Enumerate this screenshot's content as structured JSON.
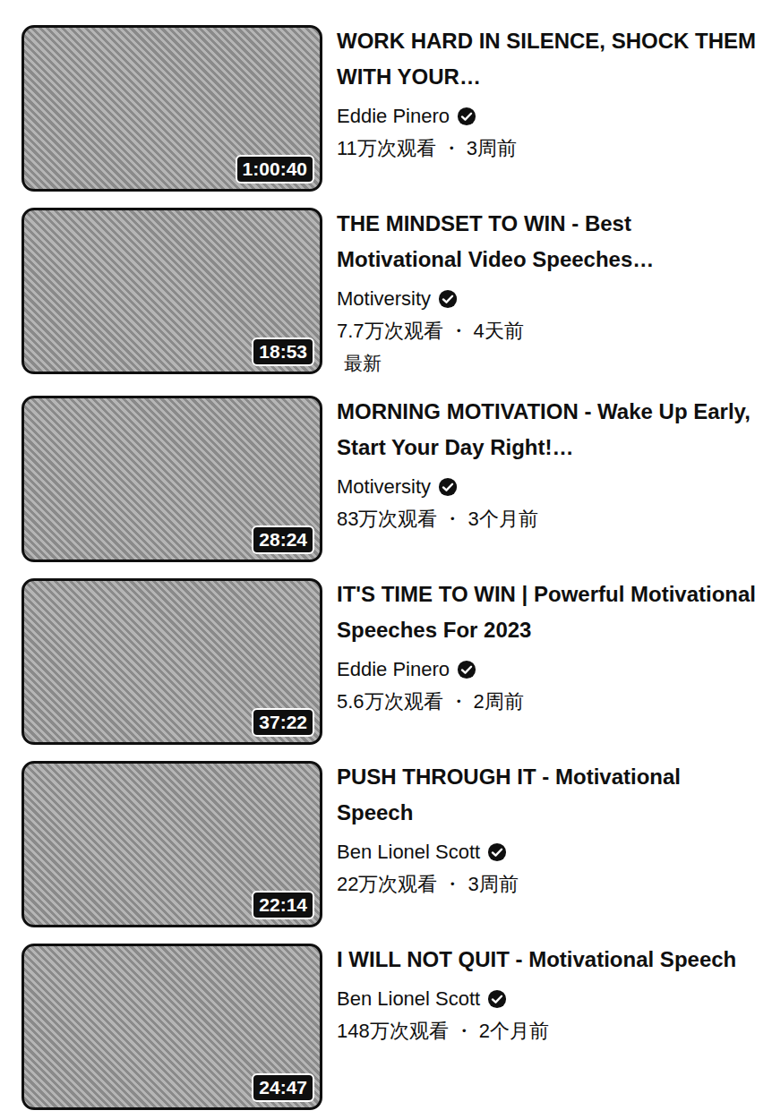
{
  "separator": "・",
  "videos": [
    {
      "title": "WORK HARD IN SILENCE, SHOCK THEM WITH YOUR…",
      "channel": "Eddie Pinero",
      "verified": true,
      "views": "11万次观看",
      "age": "3周前",
      "duration": "1:00:40"
    },
    {
      "title": "THE MINDSET TO WIN - Best Motivational Video Speeches…",
      "channel": "Motiversity",
      "verified": true,
      "views": "7.7万次观看",
      "age": "4天前",
      "duration": "18:53",
      "badge": "最新"
    },
    {
      "title": "MORNING MOTIVATION - Wake Up Early, Start Your Day Right!…",
      "channel": "Motiversity",
      "verified": true,
      "views": "83万次观看",
      "age": "3个月前",
      "duration": "28:24"
    },
    {
      "title": "IT'S TIME TO WIN | Powerful Motivational Speeches For 2023",
      "channel": "Eddie Pinero",
      "verified": true,
      "views": "5.6万次观看",
      "age": "2周前",
      "duration": "37:22"
    },
    {
      "title": "PUSH THROUGH IT - Motivational Speech",
      "channel": "Ben Lionel Scott",
      "verified": true,
      "views": "22万次观看",
      "age": "3周前",
      "duration": "22:14"
    },
    {
      "title": "I WILL NOT QUIT - Motivational Speech",
      "channel": "Ben Lionel Scott",
      "verified": true,
      "views": "148万次观看",
      "age": "2个月前",
      "duration": "24:47"
    }
  ]
}
